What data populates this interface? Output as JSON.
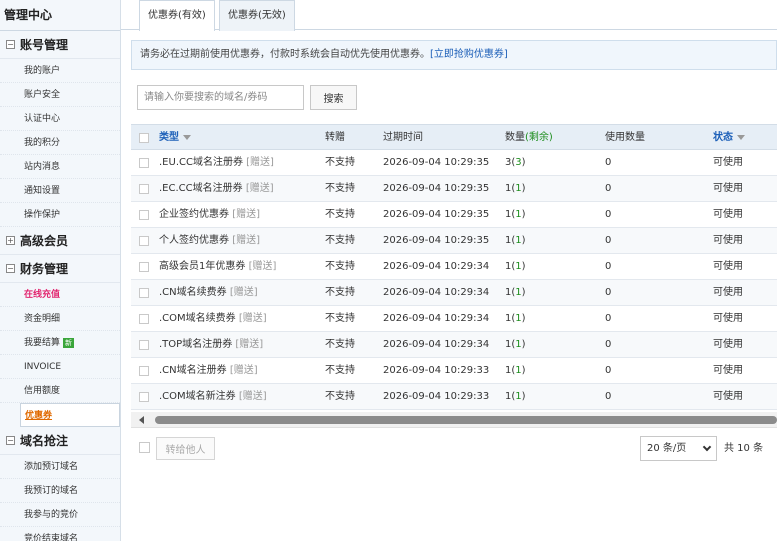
{
  "sidebar": {
    "title": "管理中心",
    "groups": [
      {
        "label": "账号管理",
        "toggle": "⊟"
      },
      {
        "label": "高级会员",
        "toggle": "⊞"
      },
      {
        "label": "财务管理",
        "toggle": "⊟"
      },
      {
        "label": "域名抢注",
        "toggle": "⊟"
      }
    ],
    "account_items": [
      "我的账户",
      "账户安全",
      "认证中心",
      "我的积分",
      "站内消息",
      "通知设置",
      "操作保护"
    ],
    "finance_items": [
      "在线充值",
      "资金明细",
      "我要结算",
      "INVOICE",
      "信用额度",
      "优惠券"
    ],
    "finance_badge": "新",
    "snatch_items": [
      "添加预订域名",
      "我预订的域名",
      "我参与的竞价",
      "竞价结束域名"
    ]
  },
  "tabs": [
    {
      "label": "优惠券(有效)",
      "active": true
    },
    {
      "label": "优惠券(无效)",
      "active": false
    }
  ],
  "notice": {
    "text": "请务必在过期前使用优惠券，付款时系统会自动优先使用优惠券。",
    "link": "[立即抢购优惠券]"
  },
  "search": {
    "placeholder": "请输入你要搜索的域名/券码",
    "button": "搜索"
  },
  "table": {
    "headers": {
      "type": "类型",
      "transfer": "转赠",
      "expire": "过期时间",
      "qty": "数量",
      "qty_remaining": "(剩余)",
      "used": "使用数量",
      "status": "状态"
    },
    "rows": [
      {
        "type": ".EU.CC域名注册券",
        "gift": "[赠送]",
        "transfer": "不支持",
        "expire": "2026-09-04 10:29:35",
        "qty": "3",
        "remaining": "3",
        "used": "0",
        "status": "可使用"
      },
      {
        "type": ".EC.CC域名注册券",
        "gift": "[赠送]",
        "transfer": "不支持",
        "expire": "2026-09-04 10:29:35",
        "qty": "1",
        "remaining": "1",
        "used": "0",
        "status": "可使用"
      },
      {
        "type": "企业签约优惠券",
        "gift": "[赠送]",
        "transfer": "不支持",
        "expire": "2026-09-04 10:29:35",
        "qty": "1",
        "remaining": "1",
        "used": "0",
        "status": "可使用"
      },
      {
        "type": "个人签约优惠券",
        "gift": "[赠送]",
        "transfer": "不支持",
        "expire": "2026-09-04 10:29:35",
        "qty": "1",
        "remaining": "1",
        "used": "0",
        "status": "可使用"
      },
      {
        "type": "高级会员1年优惠券",
        "gift": "[赠送]",
        "transfer": "不支持",
        "expire": "2026-09-04 10:29:34",
        "qty": "1",
        "remaining": "1",
        "used": "0",
        "status": "可使用"
      },
      {
        "type": ".CN域名续费券",
        "gift": "[赠送]",
        "transfer": "不支持",
        "expire": "2026-09-04 10:29:34",
        "qty": "1",
        "remaining": "1",
        "used": "0",
        "status": "可使用"
      },
      {
        "type": ".COM域名续费券",
        "gift": "[赠送]",
        "transfer": "不支持",
        "expire": "2026-09-04 10:29:34",
        "qty": "1",
        "remaining": "1",
        "used": "0",
        "status": "可使用"
      },
      {
        "type": ".TOP域名注册券",
        "gift": "[赠送]",
        "transfer": "不支持",
        "expire": "2026-09-04 10:29:34",
        "qty": "1",
        "remaining": "1",
        "used": "0",
        "status": "可使用"
      },
      {
        "type": ".CN域名注册券",
        "gift": "[赠送]",
        "transfer": "不支持",
        "expire": "2026-09-04 10:29:33",
        "qty": "1",
        "remaining": "1",
        "used": "0",
        "status": "可使用"
      },
      {
        "type": ".COM域名新注券",
        "gift": "[赠送]",
        "transfer": "不支持",
        "expire": "2026-09-04 10:29:33",
        "qty": "1",
        "remaining": "1",
        "used": "0",
        "status": "可使用"
      }
    ]
  },
  "footer": {
    "transfer_button": "转给他人",
    "page_size": "20 条/页",
    "total": "共 10 条"
  }
}
